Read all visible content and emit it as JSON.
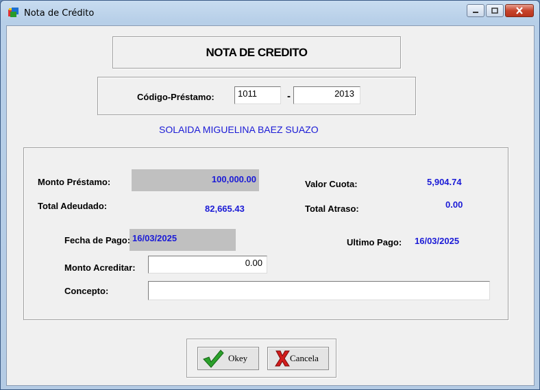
{
  "window": {
    "title": "Nota de Crédito"
  },
  "header": {
    "title": "NOTA DE CREDITO"
  },
  "codigo": {
    "label": "Código-Préstamo:",
    "part1": "1011",
    "separator": "-",
    "part2": "2013"
  },
  "client_name": "SOLAIDA MIGUELINA BAEZ SUAZO",
  "details": {
    "monto_prestamo_label": "Monto Préstamo:",
    "monto_prestamo": "100,000.00",
    "valor_cuota_label": "Valor Cuota:",
    "valor_cuota": "5,904.74",
    "total_adeudado_label": "Total Adeudado:",
    "total_adeudado": "82,665.43",
    "total_atraso_label": "Total Atraso:",
    "total_atraso": "0.00",
    "fecha_pago_label": "Fecha de Pago:",
    "fecha_pago": "16/03/2025",
    "ultimo_pago_label": "Ultimo Pago:",
    "ultimo_pago": "16/03/2025",
    "monto_acreditar_label": "Monto Acreditar:",
    "monto_acreditar": "0.00",
    "concepto_label": "Concepto:",
    "concepto": ""
  },
  "buttons": {
    "ok_label": "Okey",
    "cancel_label": "Cancela"
  },
  "colors": {
    "value_blue": "#1a1ad6",
    "readonly_gray": "#c0c0c0"
  }
}
